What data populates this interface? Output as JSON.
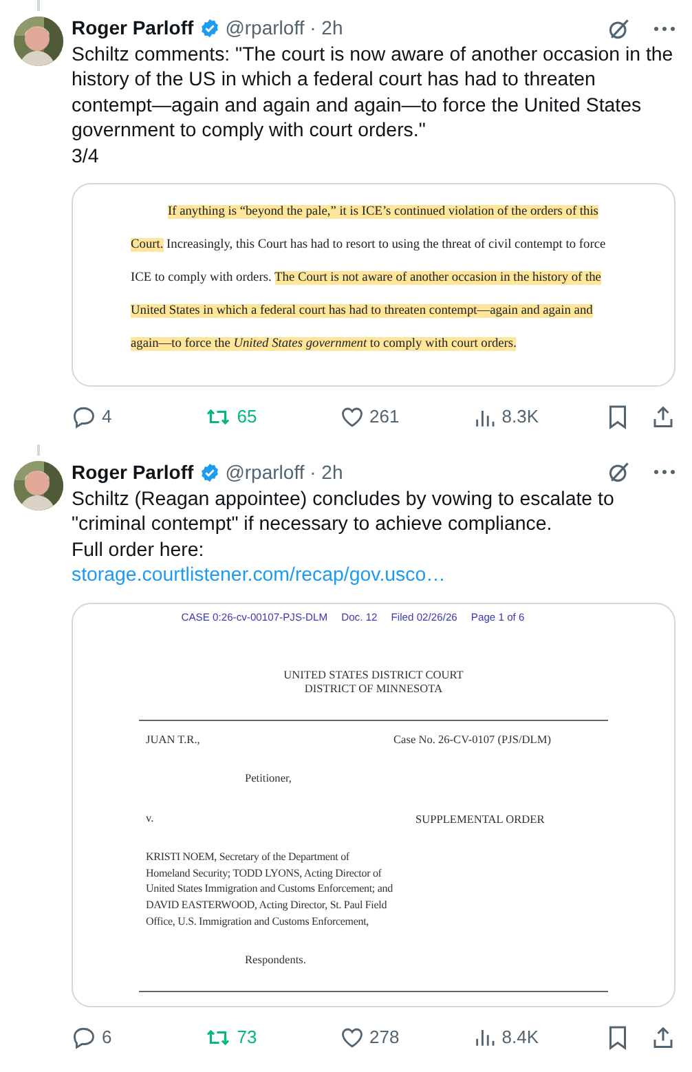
{
  "tweets": [
    {
      "author": {
        "name": "Roger Parloff",
        "verified": true,
        "meta": "@rparloff · 2h"
      },
      "paragraphs": [
        "Schiltz comments: \"The court is now aware of another occasion in the history of the US in which a federal court has had to threaten contempt—again and again and again—to force the United States government to comply with court orders.\"",
        "3/4"
      ],
      "media": {
        "kind": "excerpt",
        "segments": [
          {
            "text": "If anything is “beyond the pale,” it is ICE’s continued violation of the orders of this Court.",
            "highlighted": true
          },
          {
            "text": "Increasingly, this Court has had to resort to using the threat of civil contempt to force ICE to comply with orders.",
            "highlighted": false
          },
          {
            "text": "The Court is not aware of another occasion in the history of the United States in which a federal court has had to threaten contempt—again and again and again—to force the *United States government* to comply with court orders.",
            "highlighted": true
          }
        ]
      },
      "actions": {
        "replies": "4",
        "reposts": "65",
        "reposted": true,
        "likes": "261",
        "liked": false,
        "views": "8.3K"
      }
    },
    {
      "author": {
        "name": "Roger Parloff",
        "verified": true,
        "meta": "@rparloff · 2h"
      },
      "paragraphs": [
        "Schiltz (Reagan appointee) concludes by vowing to escalate to \"criminal contempt\" if necessary to achieve compliance.",
        "Full order here:"
      ],
      "link": "storage.courtlistener.com/recap/gov.usco…",
      "media": {
        "kind": "document",
        "header": [
          "CASE 0:26-cv-00107-PJS-DLM",
          "Doc. 12",
          "Filed 02/26/26",
          "Page 1 of 6"
        ],
        "court": [
          "UNITED STATES DISTRICT COURT",
          "DISTRICT OF MINNESOTA"
        ],
        "petitioner": "JUAN T.R.,",
        "petitioner_role": "Petitioner,",
        "versus": "v.",
        "respondents": "KRISTI NOEM, Secretary of the Department of Homeland Security;  TODD LYONS, Acting Director of United States Immigration and Customs Enforcement; and DAVID EASTERWOOD, Acting Director, St. Paul Field Office, U.S. Immigration and Customs Enforcement,",
        "respondents_role": "Respondents.",
        "case_number": "Case No. 26-CV-0107 (PJS/DLM)",
        "title": "SUPPLEMENTAL ORDER"
      },
      "actions": {
        "replies": "6",
        "reposts": "73",
        "reposted": true,
        "likes": "278",
        "liked": false,
        "views": "8.4K"
      }
    }
  ]
}
